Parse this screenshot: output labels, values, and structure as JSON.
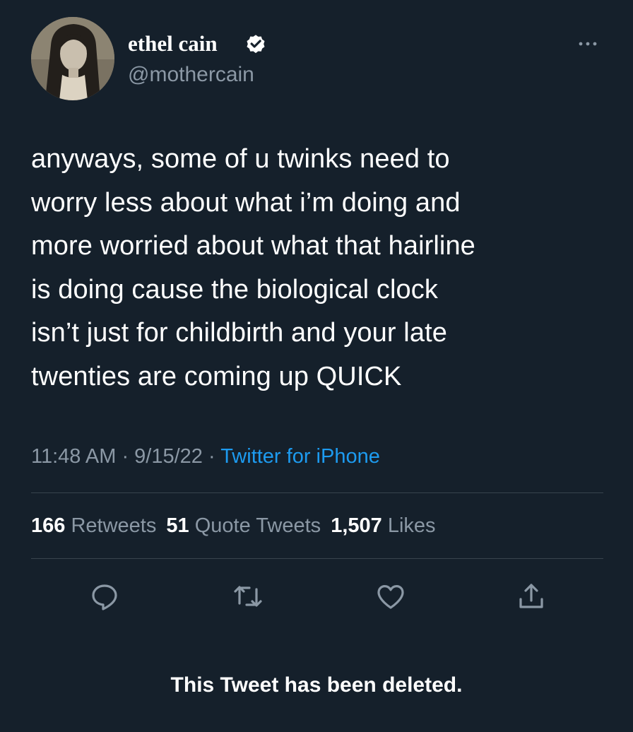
{
  "author": {
    "display_name": "ethel cain",
    "handle": "@mothercain",
    "verified_icon": "verified-badge-icon",
    "avatar_icon": "avatar-photo"
  },
  "more_icon": "more-options-icon",
  "tweet": {
    "lines": [
      "anyways, some of u twinks need to",
      "worry less about what i’m doing and",
      "more worried about what that hairline",
      "is doing cause the biological clock",
      "isn’t just for childbirth and your late",
      "twenties are coming up QUICK"
    ]
  },
  "meta": {
    "time": "11:48 AM",
    "separator": " · ",
    "date": "9/15/22",
    "source": "Twitter for iPhone"
  },
  "stats": {
    "retweets_count": "166",
    "retweets_label": "Retweets",
    "quotes_count": "51",
    "quotes_label": "Quote Tweets",
    "likes_count": "1,507",
    "likes_label": "Likes"
  },
  "actions": [
    "reply-icon",
    "retweet-icon",
    "like-icon",
    "share-icon"
  ],
  "status": {
    "deleted_text": "This Tweet has been deleted."
  },
  "colors": {
    "background": "#15202b",
    "text": "#ffffff",
    "secondary": "#8b98a5",
    "accent": "#1d9bf0",
    "divider": "#38444d"
  }
}
